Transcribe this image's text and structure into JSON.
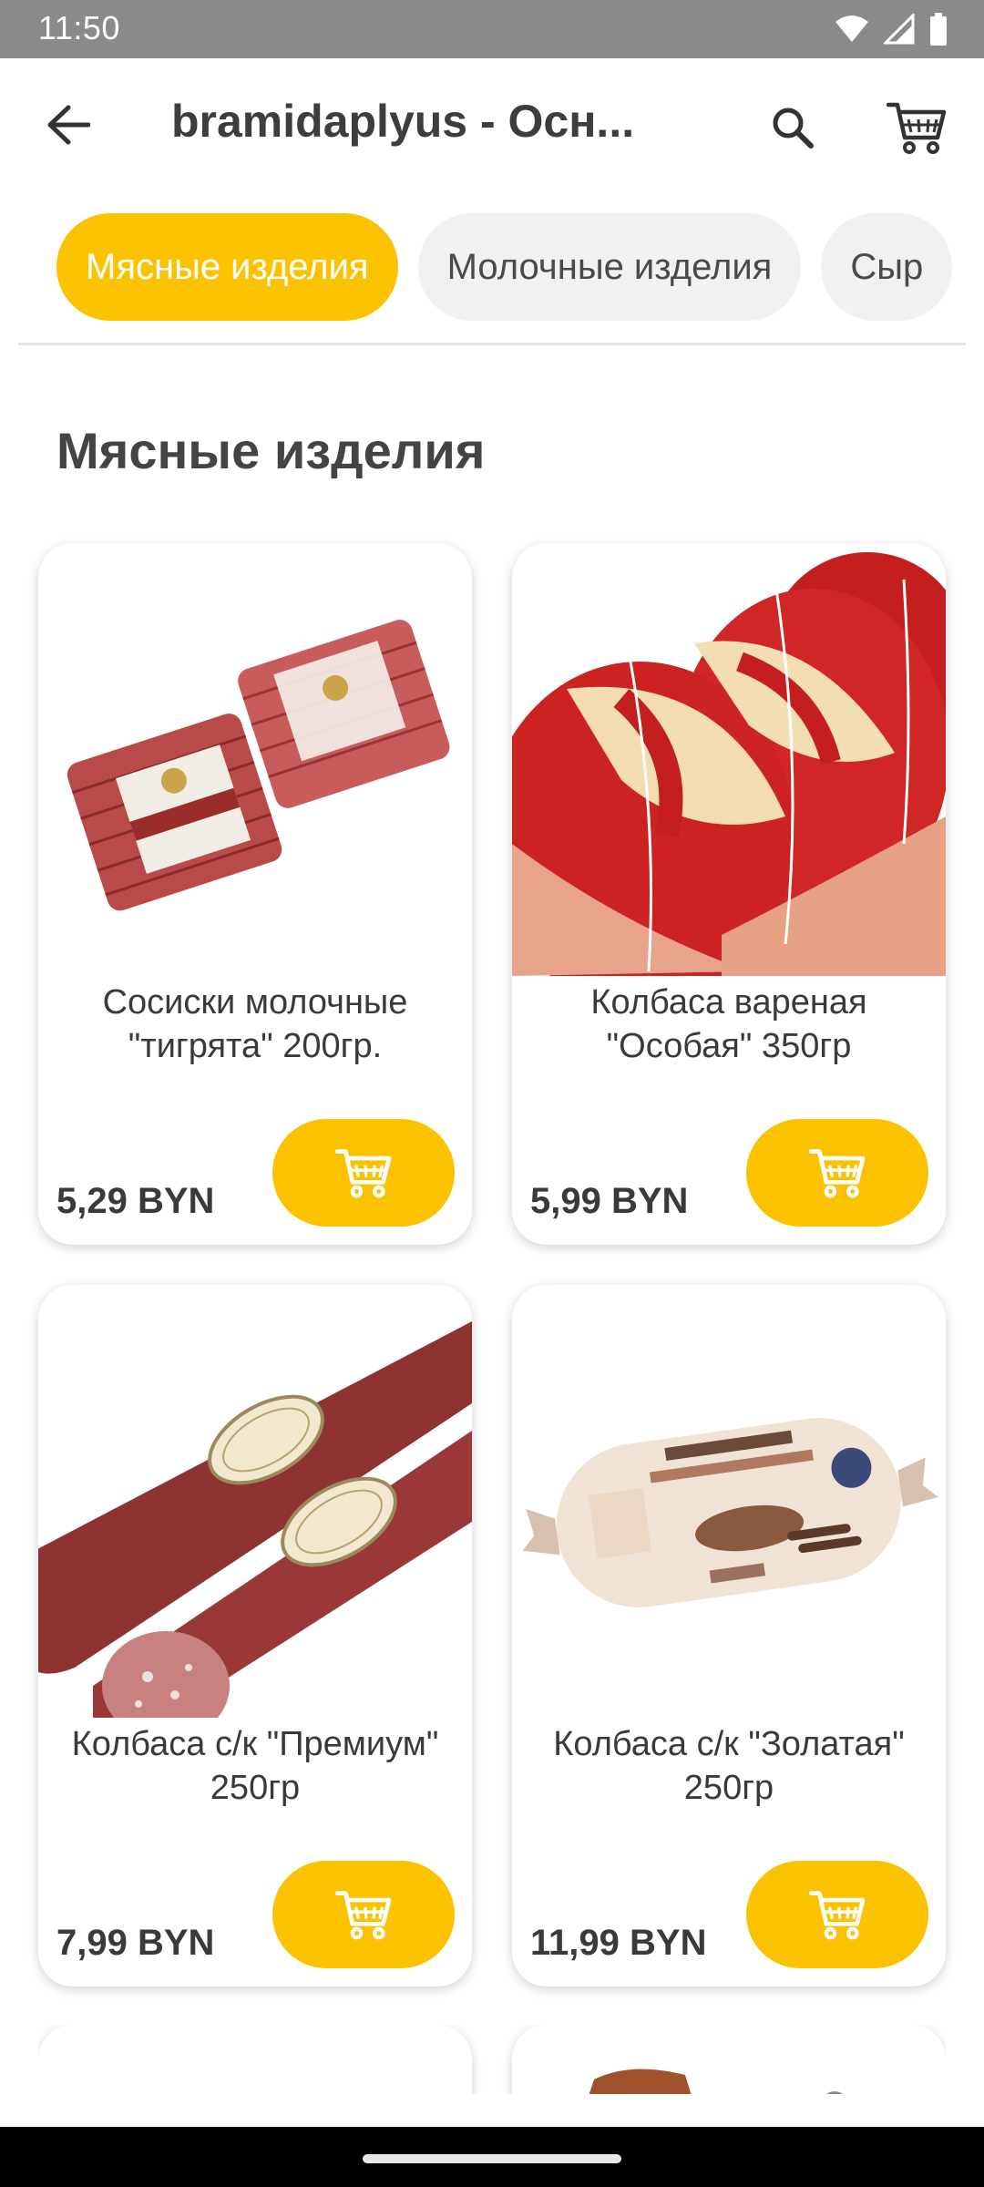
{
  "status_bar": {
    "time": "11:50",
    "icons": [
      "wifi-icon",
      "signal-icon",
      "battery-icon"
    ]
  },
  "app_bar": {
    "title": "bramidaplyus - Осн...",
    "back_icon": "back-arrow-icon",
    "search_icon": "search-icon",
    "cart_icon": "cart-icon"
  },
  "categories": [
    {
      "label": "Мясные изделия",
      "active": true
    },
    {
      "label": "Молочные изделия",
      "active": false
    },
    {
      "label": "Сыр",
      "active": false
    }
  ],
  "section": {
    "title": "Мясные изделия"
  },
  "products": [
    {
      "name": "Сосиски молочные \"тигрята\" 200гр.",
      "price": "5,29 BYN"
    },
    {
      "name": "Колбаса вареная \"Особая\" 350гр",
      "price": "5,99 BYN"
    },
    {
      "name": "Колбаса с/к \"Премиум\" 250гр",
      "price": "7,99 BYN"
    },
    {
      "name": "Колбаса с/к \"Золатая\" 250гр",
      "price": "11,99 BYN"
    }
  ],
  "colors": {
    "accent": "#fbc200",
    "chip_inactive": "#f1f1f1",
    "status_bar": "#8a8a8a"
  }
}
